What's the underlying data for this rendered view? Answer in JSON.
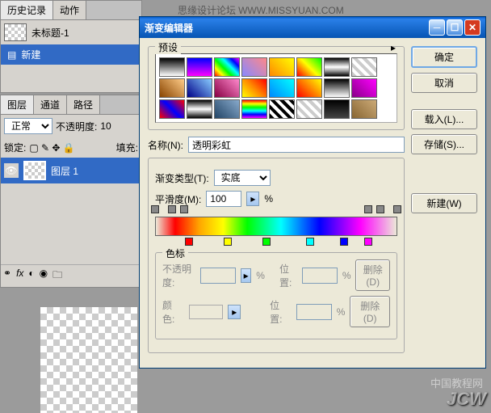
{
  "header_forum": "思缘设计论坛",
  "header_url": "WWW.MISSYUAN.COM",
  "history_panel": {
    "tabs": [
      "历史记录",
      "动作"
    ],
    "doc_title": "未标题-1",
    "new_label": "新建"
  },
  "layers_panel": {
    "tabs": [
      "图层",
      "通道",
      "路径"
    ],
    "blend_mode": "正常",
    "opacity_label": "不透明度:",
    "opacity_value": "10",
    "lock_label": "锁定:",
    "fill_label": "填充:",
    "layer_name": "图层 1"
  },
  "dialog": {
    "title": "渐变编辑器",
    "buttons": {
      "ok": "确定",
      "cancel": "取消",
      "load": "载入(L)...",
      "save": "存储(S)...",
      "new": "新建(W)"
    },
    "presets_label": "预设",
    "name_label": "名称(N):",
    "name_value": "透明彩虹",
    "grad_type_label": "渐变类型(T):",
    "grad_type_value": "实底",
    "smooth_label": "平滑度(M):",
    "smooth_value": "100",
    "percent": "%",
    "stops_label": "色标",
    "opacity_label": "不透明度:",
    "position_label": "位置:",
    "color_label": "颜色:",
    "delete_label": "删除(D)"
  },
  "chart_data": {
    "type": "gradient",
    "opacity_stops": [
      {
        "pos": 0,
        "opacity": 0
      },
      {
        "pos": 7,
        "opacity": 100
      },
      {
        "pos": 12,
        "opacity": 100
      },
      {
        "pos": 88,
        "opacity": 100
      },
      {
        "pos": 93,
        "opacity": 100
      },
      {
        "pos": 100,
        "opacity": 0
      }
    ],
    "color_stops": [
      {
        "pos": 14,
        "color": "#ff0000"
      },
      {
        "pos": 30,
        "color": "#ffff00"
      },
      {
        "pos": 46,
        "color": "#00ff00"
      },
      {
        "pos": 64,
        "color": "#00ffff"
      },
      {
        "pos": 78,
        "color": "#0000ff"
      },
      {
        "pos": 88,
        "color": "#ff00ff"
      }
    ]
  },
  "presets": [
    "linear-gradient(#000,#fff)",
    "linear-gradient(#00f,#f0f)",
    "linear-gradient(45deg,#f00,#ff0,#0f0,#0ff,#00f,#f0f)",
    "linear-gradient(45deg,#88f,#f88)",
    "linear-gradient(45deg,#f80,#ff0)",
    "linear-gradient(45deg,#f00,#ff0,#0f0)",
    "linear-gradient(#000,#888,#fff,#888,#000)",
    "repeating-linear-gradient(45deg,#ccc 0 4px,#fff 4px 8px)",
    "linear-gradient(45deg,#840,#fc8)",
    "linear-gradient(45deg,#008,#8cf)",
    "linear-gradient(45deg,#804,#f8c)",
    "linear-gradient(45deg,#ff0,#f80,#f00)",
    "linear-gradient(45deg,#08f,#0ff)",
    "linear-gradient(45deg,#f00,#ff0)",
    "linear-gradient(#000,#fff)",
    "linear-gradient(45deg,#808,#f0f)",
    "linear-gradient(45deg,#f00,#00f,#f00)",
    "linear-gradient(#000,#fff,#000)",
    "linear-gradient(45deg,#246,#8ac)",
    "linear-gradient(#f00,#ff0,#0f0,#0ff,#00f,#f0f)",
    "repeating-linear-gradient(45deg,#000 0 4px,#fff 4px 8px)",
    "repeating-linear-gradient(45deg,#ccc 0 4px,#fff 4px 8px)",
    "linear-gradient(#000,#444)",
    "linear-gradient(45deg,#863,#ca7)"
  ],
  "watermarks": {
    "cn": "中国教程网",
    "en": "JCW"
  }
}
